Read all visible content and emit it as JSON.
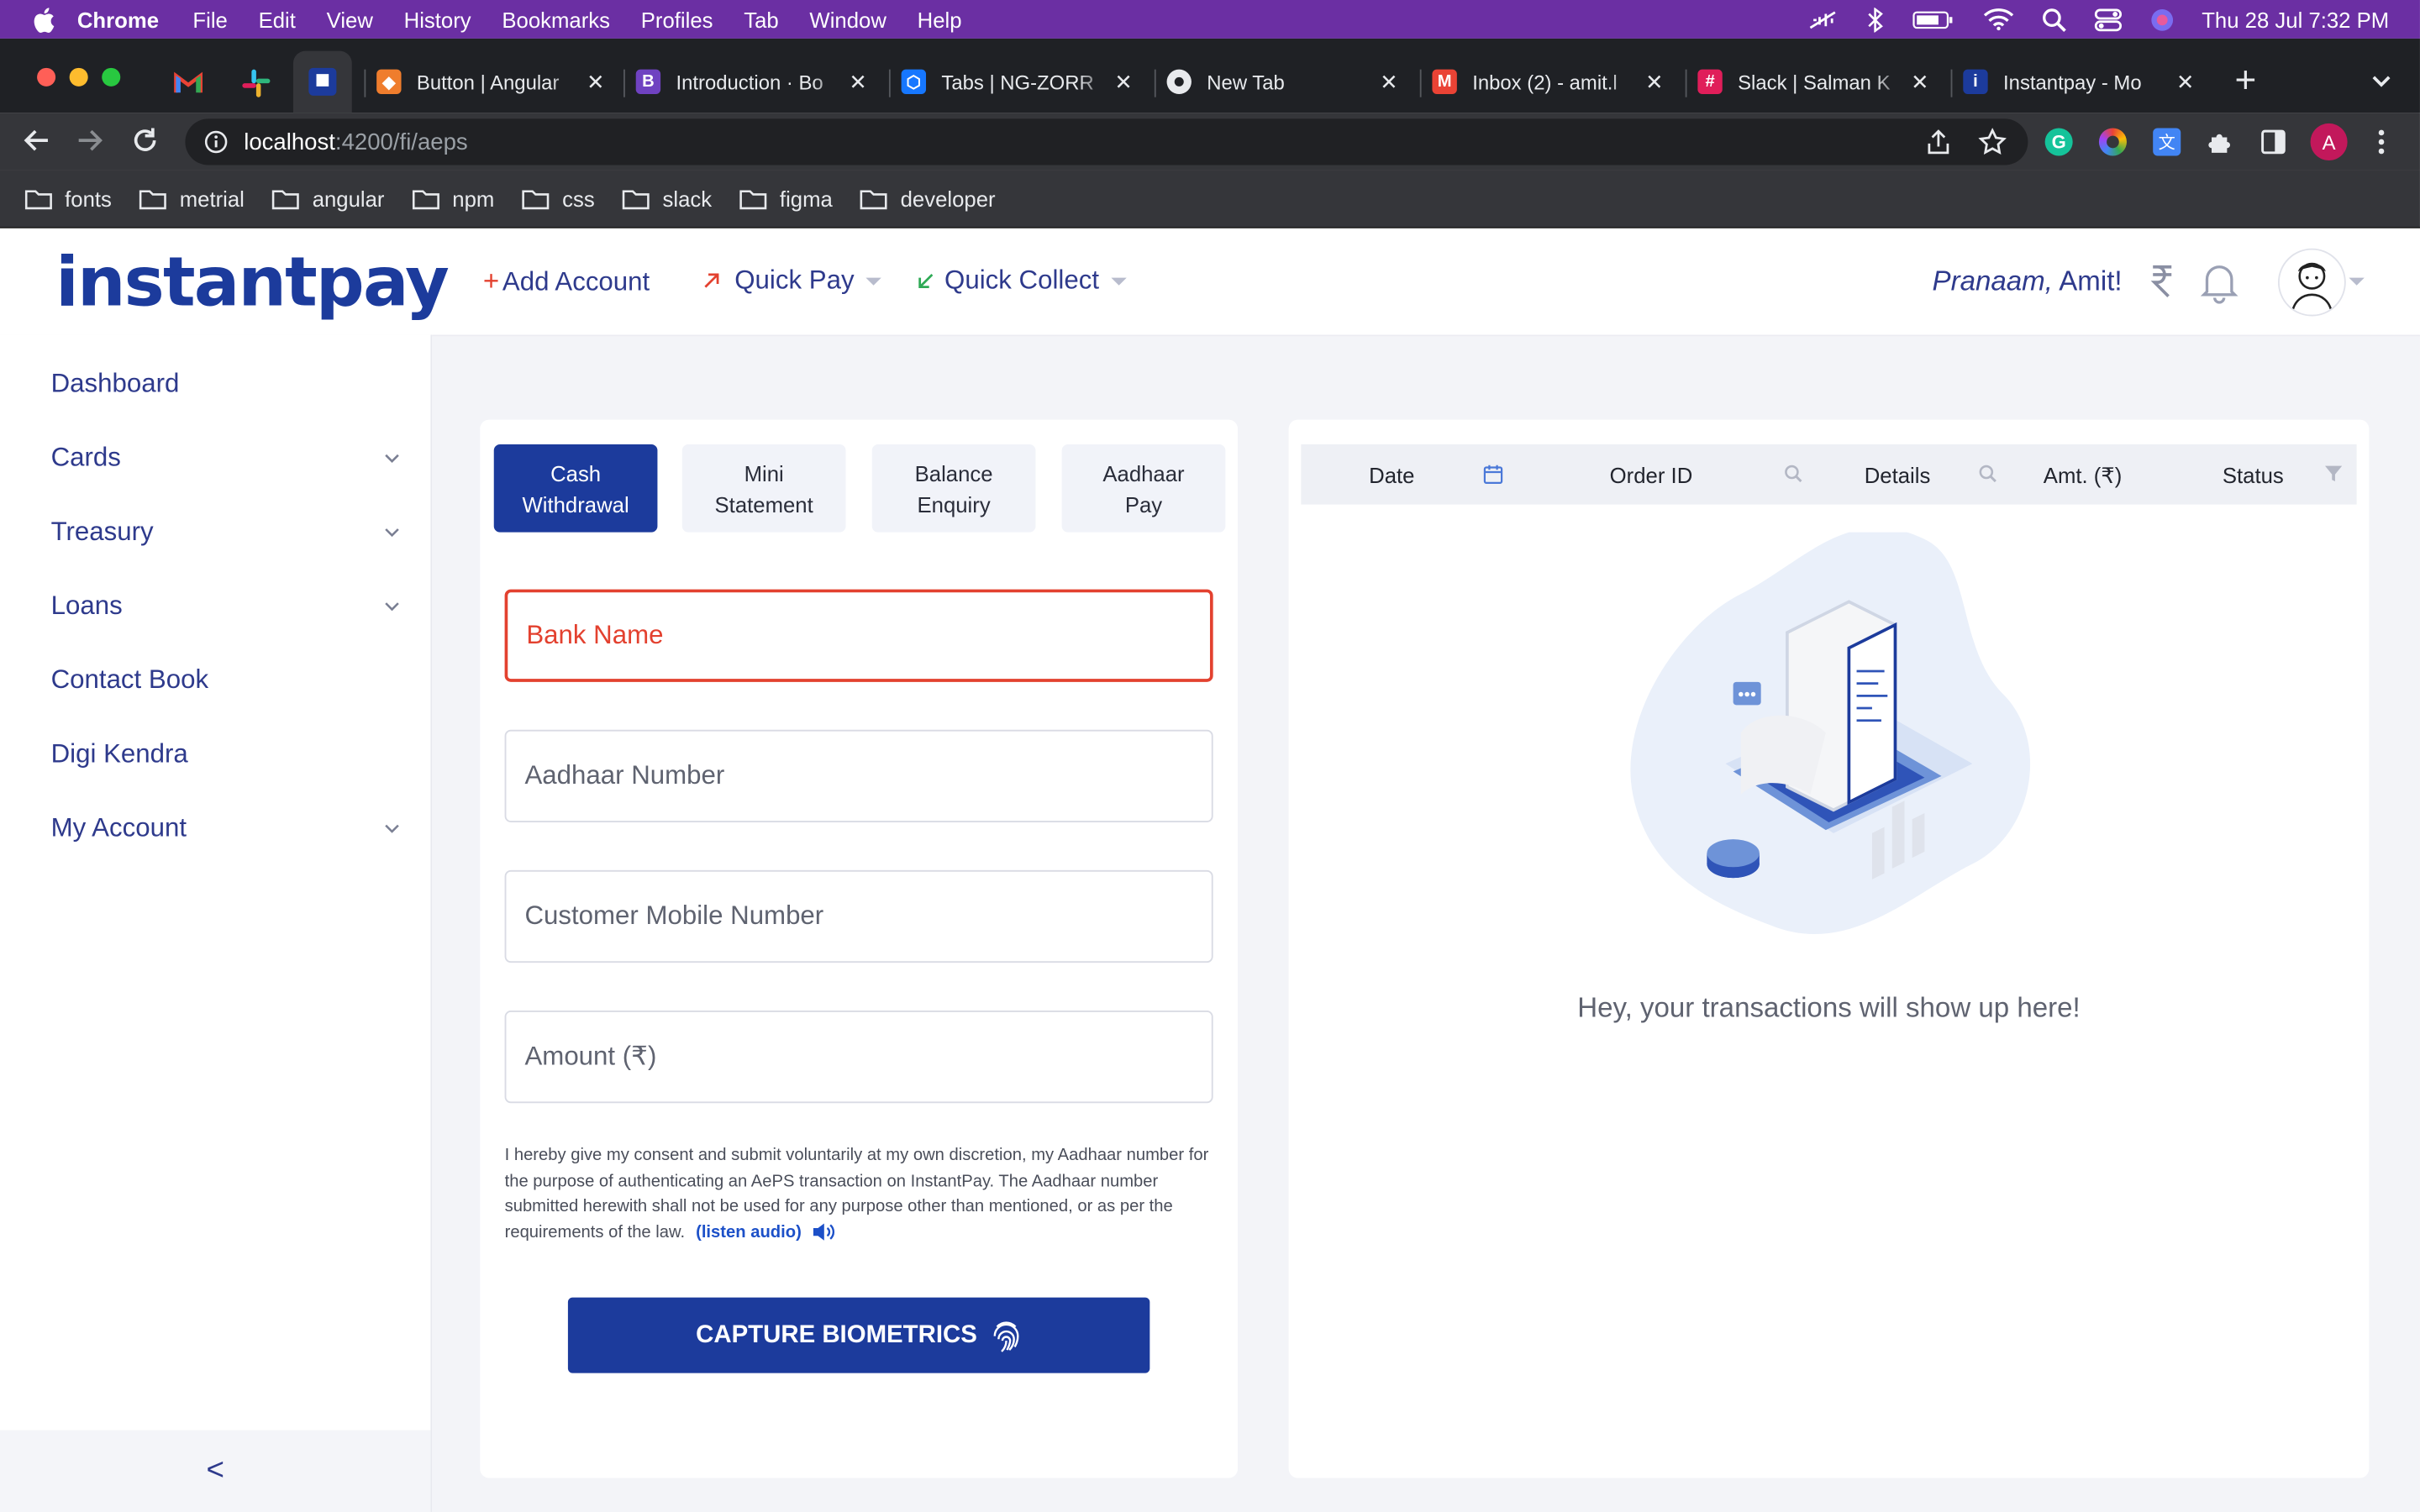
{
  "menubar": {
    "app": "Chrome",
    "items": [
      "File",
      "Edit",
      "View",
      "History",
      "Bookmarks",
      "Profiles",
      "Tab",
      "Window",
      "Help"
    ],
    "clock": "Thu 28 Jul  7:32 PM"
  },
  "tabs": [
    {
      "title": "Button | Angular",
      "icon": "angular-icon",
      "color": "#ef7d2d"
    },
    {
      "title": "Introduction · Bo",
      "icon": "bootstrap-icon",
      "color": "#6f42c1"
    },
    {
      "title": "Tabs | NG-ZORR",
      "icon": "ngzorro-icon",
      "color": "#1677ff"
    },
    {
      "title": "New Tab",
      "icon": "chrome-icon",
      "color": "#e8eaed"
    },
    {
      "title": "Inbox (2) - amit.l",
      "icon": "gmail-icon",
      "color": "#ea4335"
    },
    {
      "title": "Slack | Salman K",
      "icon": "slack-icon",
      "color": "#e01e5a"
    },
    {
      "title": "Instantpay - Mo",
      "icon": "instantpay-icon",
      "color": "#1c3b9c"
    }
  ],
  "address": {
    "host": "localhost",
    "path": ":4200/fi/aeps"
  },
  "bookmarks": [
    "fonts",
    "metrial",
    "angular",
    "npm",
    "css",
    "slack",
    "figma",
    "developer"
  ],
  "profile_initial": "A",
  "header": {
    "logo": "instantpay",
    "add_account": "Add Account",
    "quick_pay": "Quick Pay",
    "quick_collect": "Quick Collect",
    "greeting_italic": "Pranaam,",
    "greeting_name": " Amit!"
  },
  "sidebar": {
    "items": [
      {
        "label": "Dashboard",
        "expandable": false
      },
      {
        "label": "Cards",
        "expandable": true
      },
      {
        "label": "Treasury",
        "expandable": true
      },
      {
        "label": "Loans",
        "expandable": true
      },
      {
        "label": "Contact Book",
        "expandable": false
      },
      {
        "label": "Digi Kendra",
        "expandable": false
      },
      {
        "label": "My Account",
        "expandable": true
      }
    ],
    "collapse_glyph": "<"
  },
  "service_tabs": [
    {
      "line1": "Cash",
      "line2": "Withdrawal"
    },
    {
      "line1": "Mini",
      "line2": "Statement"
    },
    {
      "line1": "Balance",
      "line2": "Enquiry"
    },
    {
      "line1": "Aadhaar",
      "line2": "Pay"
    }
  ],
  "form": {
    "bank_name": "Bank Name",
    "aadhaar": "Aadhaar Number",
    "mobile": "Customer Mobile Number",
    "amount": "Amount (₹)",
    "consent": "I hereby give my consent and submit voluntarily at my own discretion, my Aadhaar number for the purpose of authenticating an AePS transaction on InstantPay. The Aadhaar number submitted herewith shall not be used for any purpose other than mentioned, or as per the requirements of the law.",
    "listen": "(listen audio)",
    "capture": "CAPTURE BIOMETRICS"
  },
  "table": {
    "columns": [
      "Date",
      "Order ID",
      "Details",
      "Amt. (₹)",
      "Status"
    ],
    "empty_message": "Hey, your transactions will show up here!"
  },
  "colors": {
    "brand": "#1c3b9c",
    "error": "#e3412f",
    "menubar": "#6b2fa3"
  }
}
